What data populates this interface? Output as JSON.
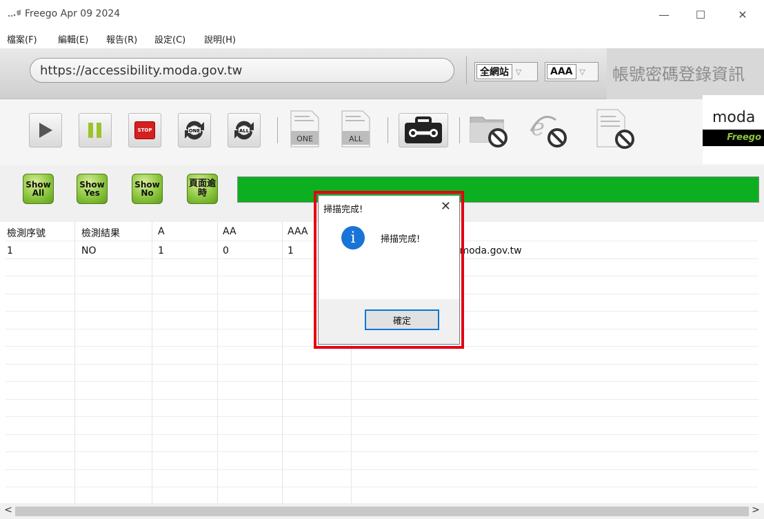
{
  "window": {
    "title": "Freego Apr 09 2024",
    "minimize": "—",
    "maximize": "☐",
    "close": "✕"
  },
  "menu": [
    {
      "label": "檔案(F)"
    },
    {
      "label": "編輯(E)"
    },
    {
      "label": "報告(R)"
    },
    {
      "label": "設定(C)"
    },
    {
      "label": "說明(H)"
    }
  ],
  "address": {
    "url": "https://accessibility.moda.gov.tw",
    "scope": "全網站",
    "level": "AAA",
    "right_label": "帳號密碼登錄資訊"
  },
  "toolbar": {
    "one_label": "ONE",
    "all_label": "ALL",
    "stop_label": "STOP"
  },
  "logo": {
    "text": "moda",
    "product": "Freego"
  },
  "filters": [
    {
      "label": "Show All"
    },
    {
      "label": "Show Yes"
    },
    {
      "label": "Show No"
    },
    {
      "label": "頁面逾時"
    }
  ],
  "progress": {
    "value": 1.0,
    "color": "#0caf20"
  },
  "table": {
    "headers": [
      "檢測序號",
      "檢測結果",
      "A",
      "AA",
      "AAA",
      ""
    ],
    "rows": [
      [
        "1",
        "NO",
        "1",
        "0",
        "1",
        ".moda.gov.tw"
      ]
    ]
  },
  "scrollbar": {
    "left": "<",
    "right": ">"
  },
  "dialog": {
    "title": "掃描完成!",
    "message": "掃描完成!",
    "ok": "確定",
    "close": "✕",
    "icon": "i"
  }
}
